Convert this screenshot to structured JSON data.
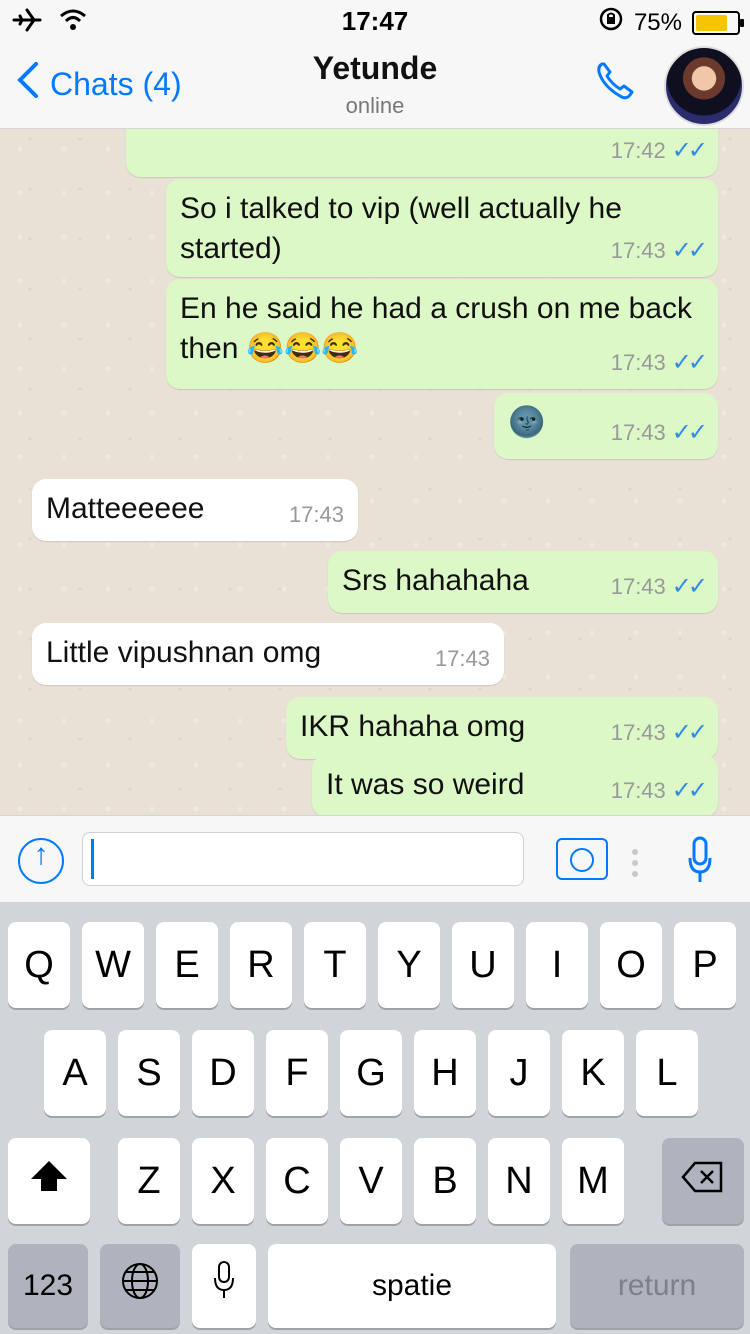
{
  "status_bar": {
    "time": "17:47",
    "battery_text": "75%",
    "battery_level": 0.75
  },
  "header": {
    "back_label": "Chats (4)",
    "contact_name": "Yetunde",
    "contact_status": "online"
  },
  "messages": [
    {
      "type": "out",
      "text": "",
      "time": "17:42"
    },
    {
      "type": "out",
      "text": "So i talked to vip (well actually he started)",
      "time": "17:43"
    },
    {
      "type": "out",
      "text": "En he said he had a crush on me back then 😂😂😂",
      "time": "17:43"
    },
    {
      "type": "out",
      "text": "🌚",
      "time": "17:43"
    },
    {
      "type": "in",
      "text": "Matteeeeee",
      "time": "17:43"
    },
    {
      "type": "out",
      "text": "Srs hahahaha",
      "time": "17:43"
    },
    {
      "type": "in",
      "text": "Little vipushnan omg",
      "time": "17:43"
    },
    {
      "type": "out",
      "text": "IKR hahaha omg",
      "time": "17:43"
    },
    {
      "type": "out",
      "text": "It was so weird",
      "time": "17:43"
    }
  ],
  "composer": {
    "placeholder": "",
    "icons": [
      "upload-icon",
      "camera-icon",
      "mic-icon"
    ]
  },
  "keyboard": {
    "row1": [
      "Q",
      "W",
      "E",
      "R",
      "T",
      "Y",
      "U",
      "I",
      "O",
      "P"
    ],
    "row2": [
      "A",
      "S",
      "D",
      "F",
      "G",
      "H",
      "J",
      "K",
      "L"
    ],
    "row3": [
      "Z",
      "X",
      "C",
      "V",
      "B",
      "N",
      "M"
    ],
    "numbers_label": "123",
    "space_label": "spatie",
    "return_label": "return"
  },
  "colors": {
    "accent": "#007aff",
    "outgoing_bubble": "#dcf8c6",
    "incoming_bubble": "#ffffff",
    "chat_background": "#e9e1d6",
    "read_ticks": "#2f8be7"
  }
}
